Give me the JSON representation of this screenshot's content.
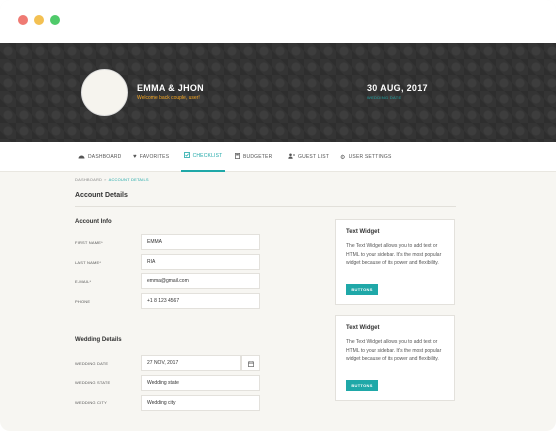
{
  "window_controls": [
    "close",
    "minimize",
    "maximize"
  ],
  "hero": {
    "couple_name": "EMMA & JHON",
    "welcome": "Welcome back couple, user!",
    "wedding_date": "30 AUG, 2017",
    "wedding_date_label": "WEDDING DATE"
  },
  "nav": {
    "items": [
      {
        "label": "DASHBOARD",
        "icon": "dashboard-icon",
        "active": false
      },
      {
        "label": "FAVORITES",
        "icon": "heart-icon",
        "active": false
      },
      {
        "label": "CHECKLIST",
        "icon": "checklist-icon",
        "active": true
      },
      {
        "label": "BUDGETER",
        "icon": "calculator-icon",
        "active": false
      },
      {
        "label": "GUEST LIST",
        "icon": "guests-icon",
        "active": false
      },
      {
        "label": "USER SETTINGS",
        "icon": "gear-icon",
        "active": false
      }
    ]
  },
  "breadcrumb": {
    "home": "DASHBOARD",
    "separator": "»",
    "current": "ACCOUNT DETAILS"
  },
  "page_title": "Account Details",
  "account_info": {
    "title": "Account Info",
    "fields": [
      {
        "label": "FIRST NAME*",
        "value": "EMMA"
      },
      {
        "label": "LAST NAME*",
        "value": "RIA"
      },
      {
        "label": "E-MAIL*",
        "value": "emma@gmail.com"
      },
      {
        "label": "PHONE",
        "value": "+1 8 123 4567"
      }
    ]
  },
  "wedding_details": {
    "title": "Wedding Details",
    "fields": [
      {
        "label": "WEDDING DATE",
        "value": "27 NOV, 2017"
      },
      {
        "label": "WEDDING STATE",
        "value": "Wedding state"
      },
      {
        "label": "WEDDING CITY",
        "value": "Wedding city"
      }
    ]
  },
  "widgets": [
    {
      "title": "Text Widget",
      "text": "The Text Widget allows you to add text or HTML to your sidebar. It's the most popular widget because of its power and flexibility.",
      "button": "BUTTONS"
    },
    {
      "title": "Text Widget",
      "text": "The Text Widget allows you to add text or HTML to your sidebar. It's the most popular widget because of its power and flexibility.",
      "button": "BUTTONS"
    }
  ],
  "colors": {
    "accent": "#1fa8a8",
    "hero_bg": "#343434",
    "welcome": "#f5a623"
  }
}
